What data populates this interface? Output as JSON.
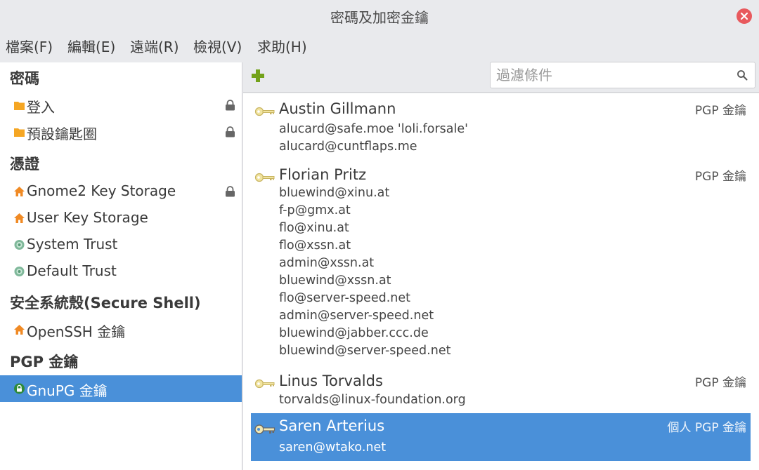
{
  "window": {
    "title": "密碼及加密金鑰"
  },
  "menu": [
    "檔案(F)",
    "編輯(E)",
    "遠端(R)",
    "檢視(V)",
    "求助(H)"
  ],
  "sidebar": {
    "headings": [
      "密碼",
      "憑證",
      "安全系統殼(Secure Shell)",
      "PGP 金鑰"
    ],
    "items": [
      {
        "label": "登入",
        "icon": "folder-icon",
        "locked": true
      },
      {
        "label": "預設鑰匙圈",
        "icon": "folder-icon",
        "locked": true
      },
      {
        "label": "Gnome2 Key Storage",
        "icon": "home-icon",
        "locked": true
      },
      {
        "label": "User Key Storage",
        "icon": "home-icon",
        "locked": false
      },
      {
        "label": "System Trust",
        "icon": "trust-icon",
        "locked": false
      },
      {
        "label": "Default Trust",
        "icon": "trust-icon",
        "locked": false
      },
      {
        "label": "OpenSSH 金鑰",
        "icon": "home-icon",
        "locked": false
      },
      {
        "label": "GnuPG 金鑰",
        "icon": "gnupg-lock-icon",
        "locked": false,
        "selected": true
      }
    ]
  },
  "toolbar": {
    "add_icon": "plus-icon",
    "search_placeholder": "過濾條件"
  },
  "keys": [
    {
      "name": "Austin Gillmann",
      "type": "PGP 金鑰",
      "emails": [
        "alucard@safe.moe 'loli.forsale'",
        "alucard@cuntflaps.me"
      ]
    },
    {
      "name": "Florian Pritz",
      "type": "PGP 金鑰",
      "emails": [
        "bluewind@xinu.at",
        "f-p@gmx.at",
        "flo@xinu.at",
        "flo@xssn.at",
        "admin@xssn.at",
        "bluewind@xssn.at",
        "flo@server-speed.net",
        "admin@server-speed.net",
        "bluewind@jabber.ccc.de",
        "bluewind@server-speed.net"
      ]
    },
    {
      "name": "Linus Torvalds",
      "type": "PGP 金鑰",
      "emails": [
        "torvalds@linux-foundation.org"
      ]
    },
    {
      "name": "Saren Arterius",
      "type": "個人 PGP 金鑰",
      "emails": [
        "saren@wtako.net"
      ],
      "selected": true
    }
  ],
  "colors": {
    "selection": "#4a90d9",
    "close": "#e8595d",
    "folder": "#f5a623",
    "home": "#f08a24",
    "add": "#73a21a"
  }
}
